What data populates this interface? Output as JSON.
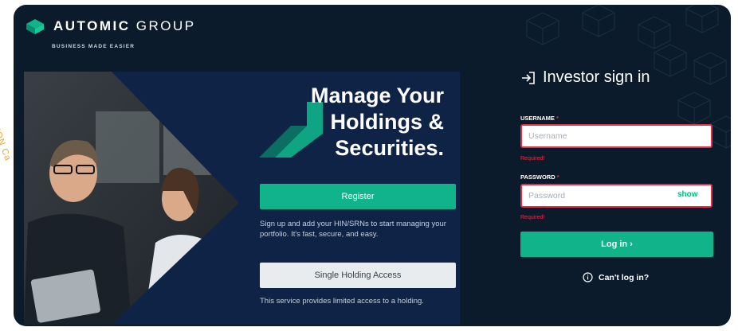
{
  "side_text": "CISION Ca",
  "brand": {
    "name_bold": "AUTOMIC",
    "name_light": "GROUP",
    "tagline": "BUSINESS MADE EASIER",
    "logo_icon": "automic-logo-icon"
  },
  "promo": {
    "title": "Manage Your Holdings & Securities.",
    "register_label": "Register",
    "register_desc": "Sign up and add your HIN/SRNs to start managing your portfolio. It's fast, secure, and easy.",
    "single_label": "Single Holding Access",
    "single_desc": "This service provides limited access to a holding."
  },
  "signin": {
    "icon": "sign-in-icon",
    "title": "Investor sign in",
    "username_label": "USERNAME",
    "username_placeholder": "Username",
    "username_error": "Required!",
    "password_label": "PASSWORD",
    "password_placeholder": "Password",
    "password_error": "Required!",
    "show_label": "show",
    "login_label": "Log in ›",
    "cant_login_label": "Can't log in?",
    "required_mark": "*"
  },
  "colors": {
    "background": "#0c1b2b",
    "panel": "#0f2346",
    "accent": "#10b38a",
    "error": "#e0304a"
  }
}
